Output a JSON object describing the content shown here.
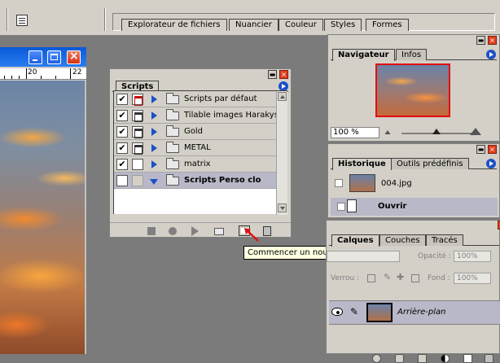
{
  "palette_well": {
    "tabs": [
      "Explorateur de fichiers",
      "Nuancier",
      "Couleur",
      "Styles",
      "Formes"
    ]
  },
  "document": {
    "ruler_labels": [
      "20",
      "22"
    ]
  },
  "scripts": {
    "tab": "Scripts",
    "items": [
      {
        "label": "Scripts par défaut",
        "checked": "✔"
      },
      {
        "label": "Tilable images Harakys",
        "checked": "✔"
      },
      {
        "label": "Gold",
        "checked": "✔"
      },
      {
        "label": "METAL",
        "checked": "✔"
      },
      {
        "label": "matrix",
        "checked": "✔"
      },
      {
        "label": "Scripts Perso clo",
        "checked": ""
      }
    ],
    "tooltip": "Commencer un nouveau script"
  },
  "navigator": {
    "tabs": [
      "Navigateur",
      "Infos"
    ],
    "zoom": "100 %"
  },
  "history": {
    "tabs": [
      "Historique",
      "Outils prédéfinis"
    ],
    "snapshot_label": "004.jpg",
    "steps": [
      "Ouvrir"
    ]
  },
  "layers": {
    "tabs": [
      "Calques",
      "Couches",
      "Tracés"
    ],
    "opacity_label": "Opacité :",
    "opacity_value": "100%",
    "lock_label": "Verrou :",
    "fill_label": "Fond :",
    "fill_value": "100%",
    "layer_name": "Arrière-plan"
  },
  "colors": {
    "accent": "#1c50c8",
    "close": "#e04020",
    "selection": "#b8b8c8",
    "tooltip_bg": "#ffffe1"
  }
}
